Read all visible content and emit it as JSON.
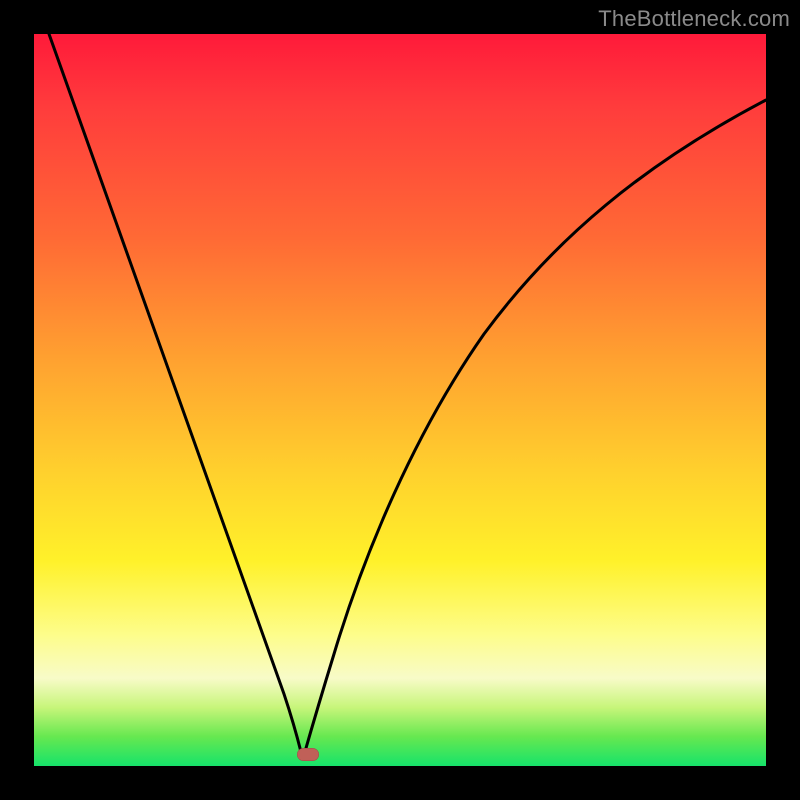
{
  "watermark": "TheBottleneck.com",
  "colors": {
    "frame": "#000000",
    "curve": "#000000",
    "marker": "#c06058",
    "gradient_top": "#ff1a3a",
    "gradient_bottom": "#16e36a"
  },
  "chart_data": {
    "type": "line",
    "title": "",
    "xlabel": "",
    "ylabel": "",
    "xlim": [
      0,
      100
    ],
    "ylim": [
      0,
      100
    ],
    "annotations": [
      {
        "text": "TheBottleneck.com",
        "position": "top-right"
      }
    ],
    "series": [
      {
        "name": "curve",
        "x": [
          2,
          5,
          10,
          15,
          20,
          25,
          30,
          33,
          35,
          36.8,
          38,
          40,
          43,
          47,
          52,
          58,
          65,
          73,
          82,
          92,
          100
        ],
        "y": [
          100,
          92,
          78,
          64,
          50,
          36,
          22,
          13,
          7,
          1.5,
          3,
          10,
          20,
          32,
          44,
          55,
          65,
          74,
          81,
          87,
          91
        ]
      }
    ],
    "marker": {
      "x": 37.5,
      "y": 1.3
    }
  }
}
